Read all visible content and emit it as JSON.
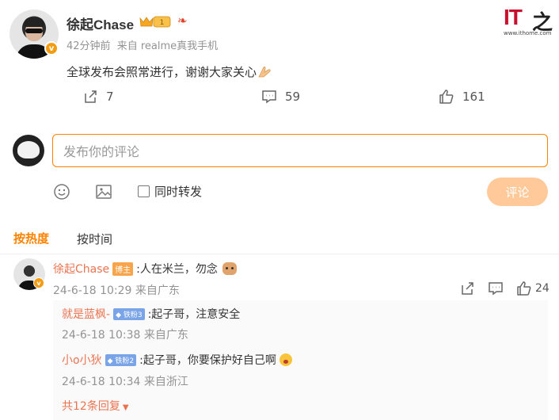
{
  "post": {
    "author": "徐起Chase",
    "verify_icon": "v",
    "vip_level": "1",
    "time": "42分钟前",
    "source": "来自 realme真我手机",
    "content": "全球发布会照常进行，谢谢大家关心"
  },
  "watermark": {
    "logo_text": "IT",
    "logo_glyph": "之",
    "url": "www.ithome.com"
  },
  "actions": {
    "repost_count": "7",
    "comment_count": "59",
    "like_count": "161"
  },
  "composer": {
    "placeholder": "发布你的评论",
    "forward_label": "同时转发",
    "submit_label": "评论"
  },
  "sort_tabs": {
    "hot": "按热度",
    "time": "按时间"
  },
  "comment": {
    "author": "徐起Chase",
    "badge": "博主",
    "text": ":人在米兰，勿念",
    "time": "24-6-18 10:29 来自广东",
    "like_count": "24"
  },
  "replies": [
    {
      "author": "就是蓝枫-",
      "badge": "铁粉3",
      "text": ":起子哥，注意安全",
      "time": "24-6-18 10:38 来自广东"
    },
    {
      "author": "小o小狄",
      "badge": "铁粉2",
      "text": ":起子哥，你要保护好自己啊",
      "time": "24-6-18 10:34 来自浙江"
    }
  ],
  "more_replies": "共12条回复",
  "colors": {
    "accent": "#ff8200",
    "link": "#eb7350",
    "meta": "#939393"
  }
}
